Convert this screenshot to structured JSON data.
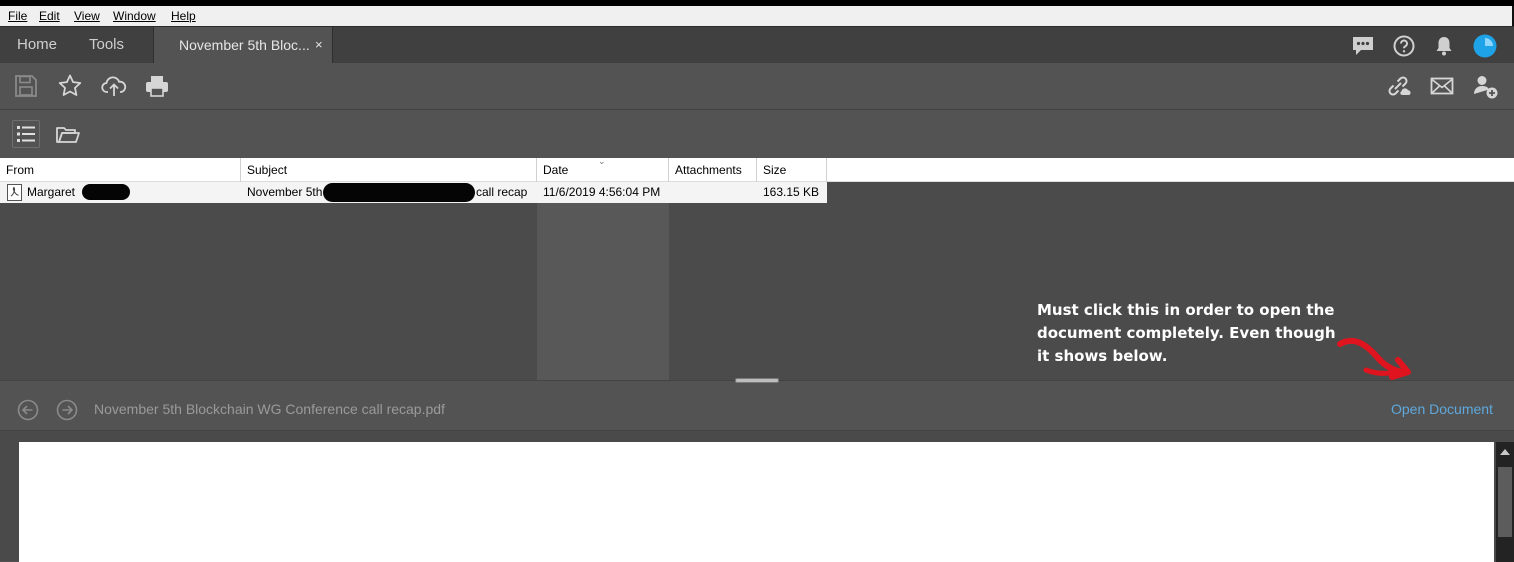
{
  "menu": [
    "File",
    "Edit",
    "View",
    "Window",
    "Help"
  ],
  "tabs": {
    "home": "Home",
    "tools": "Tools",
    "document": "November 5th Bloc...",
    "close": "×"
  },
  "header_icons": [
    "chat-icon",
    "help-icon",
    "bell-icon",
    "account-avatar-icon"
  ],
  "toolbar_left_icons": [
    "save-icon",
    "star-icon",
    "cloud-upload-icon",
    "print-icon"
  ],
  "toolbar_right_icons": [
    "share-link-icon",
    "email-icon",
    "add-user-icon"
  ],
  "attachments_toolbar_icons": [
    "list-view-icon",
    "open-folder-icon"
  ],
  "table": {
    "columns": [
      "From",
      "Subject",
      "Date",
      "Attachments",
      "Size"
    ],
    "rows": [
      {
        "from": "Margaret",
        "subject_start": "November 5th",
        "subject_end": "call recap",
        "date": "11/6/2019 4:56:04 PM",
        "attachments": "",
        "size": "163.15 KB"
      }
    ]
  },
  "preview": {
    "filename": "November 5th Blockchain WG Conference call recap.pdf",
    "open_document": "Open Document"
  },
  "annotation": {
    "text": "Must click this in order to open the document completely. Even though it shows below.",
    "arrow_color": "#e0141e"
  },
  "colors": {
    "accent_link": "#5fa8dc",
    "avatar": "#1fa3e8"
  }
}
